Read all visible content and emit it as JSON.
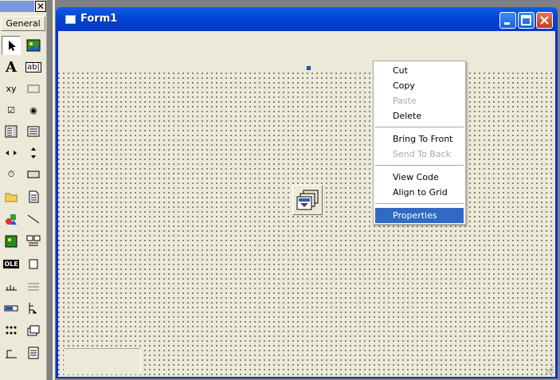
{
  "toolbox": {
    "close_glyph": "✕",
    "tab_label": "General",
    "tools": [
      {
        "name": "pointer-icon"
      },
      {
        "name": "picturebox-icon"
      },
      {
        "name": "label-icon",
        "glyph": "A"
      },
      {
        "name": "textbox-icon",
        "glyph": "ab|"
      },
      {
        "name": "frame-icon",
        "glyph": "xy"
      },
      {
        "name": "commandbutton-icon"
      },
      {
        "name": "checkbox-icon",
        "glyph": "☑"
      },
      {
        "name": "optionbutton-icon",
        "glyph": "◉"
      },
      {
        "name": "combobox-icon"
      },
      {
        "name": "listbox-icon"
      },
      {
        "name": "hscrollbar-icon"
      },
      {
        "name": "vscrollbar-icon"
      },
      {
        "name": "timer-icon",
        "glyph": "⏱"
      },
      {
        "name": "drivelistbox-icon"
      },
      {
        "name": "dirlistbox-icon"
      },
      {
        "name": "filelistbox-icon"
      },
      {
        "name": "shape-icon"
      },
      {
        "name": "line-icon"
      },
      {
        "name": "image-icon"
      },
      {
        "name": "data-icon"
      },
      {
        "name": "ole-icon",
        "glyph": "OLE"
      },
      {
        "name": "tool-22-icon"
      },
      {
        "name": "tool-23-icon"
      },
      {
        "name": "tool-24-icon"
      },
      {
        "name": "progressbar-icon"
      },
      {
        "name": "treeview-icon"
      },
      {
        "name": "tool-27-icon"
      },
      {
        "name": "tool-28-icon"
      },
      {
        "name": "tool-29-icon"
      },
      {
        "name": "tool-30-icon"
      }
    ]
  },
  "form": {
    "title": "Form1"
  },
  "context_menu": {
    "items": [
      {
        "label": "Cut",
        "enabled": true
      },
      {
        "label": "Copy",
        "enabled": true
      },
      {
        "label": "Paste",
        "enabled": false
      },
      {
        "label": "Delete",
        "enabled": true
      },
      {
        "separator": true
      },
      {
        "label": "Bring To Front",
        "enabled": true
      },
      {
        "label": "Send To Back",
        "enabled": false
      },
      {
        "separator": true
      },
      {
        "label": "View Code",
        "enabled": true
      },
      {
        "label": "Align to Grid",
        "enabled": true
      },
      {
        "separator": true
      },
      {
        "label": "Properties",
        "enabled": true,
        "highlighted": true
      }
    ]
  },
  "colors": {
    "title_bar": "#0445d6",
    "highlight": "#316ac5",
    "disabled_text": "#aca899"
  }
}
